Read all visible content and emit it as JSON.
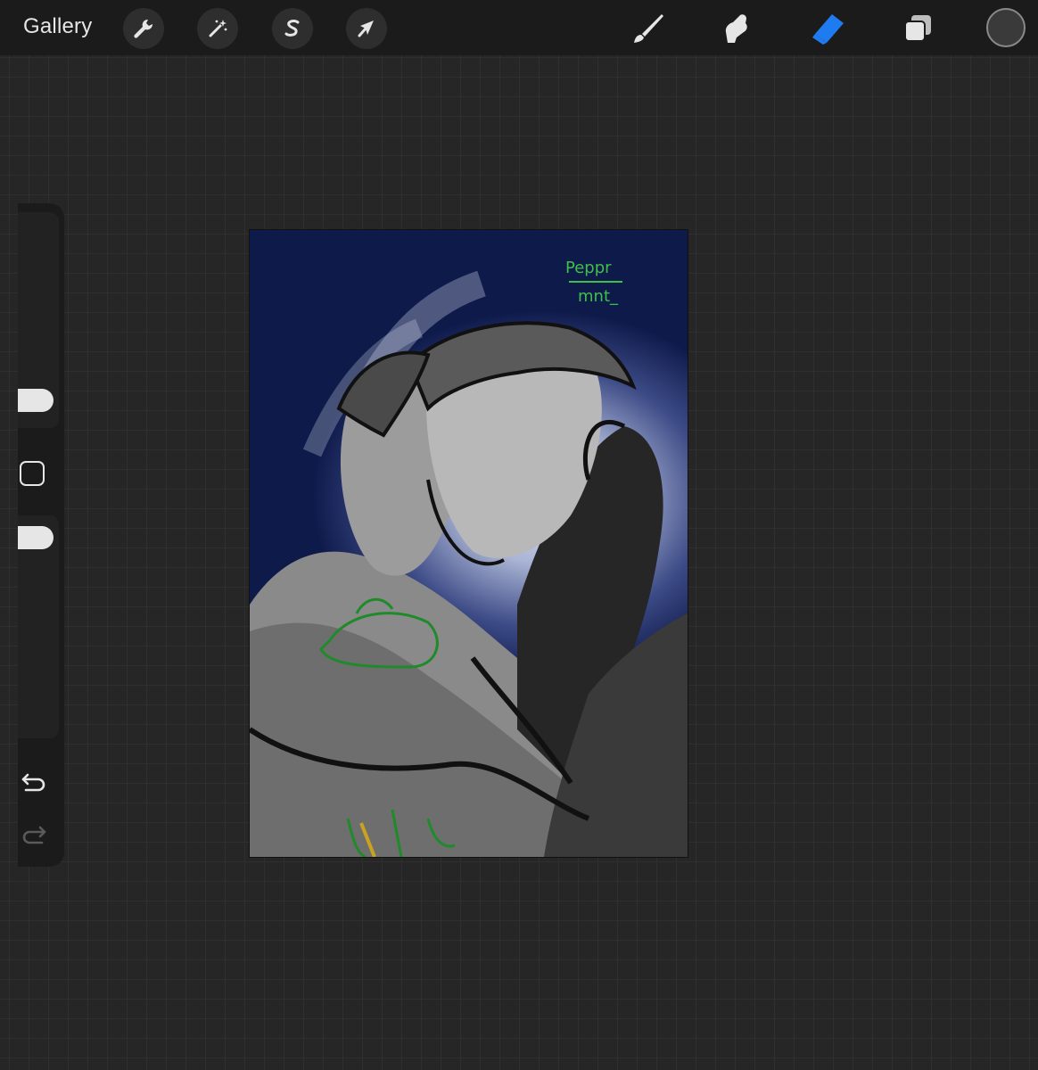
{
  "topbar": {
    "gallery_label": "Gallery",
    "left_tools": [
      "wrench-icon",
      "magic-wand-icon",
      "selection-s-icon",
      "transform-arrow-icon"
    ],
    "right_tools": [
      "brush-icon",
      "smudge-icon",
      "eraser-icon",
      "layers-icon"
    ],
    "active_tool": "eraser",
    "accent_color": "#1e7bf0",
    "current_color": "#3a3a3a"
  },
  "sidebar": {
    "controls": [
      "brush-size-slider",
      "modify-button",
      "opacity-slider",
      "undo-icon",
      "redo-icon"
    ]
  },
  "canvas": {
    "signature_lines": [
      "Peppr",
      "mnt_"
    ],
    "signature_color": "#3fbf4a"
  }
}
